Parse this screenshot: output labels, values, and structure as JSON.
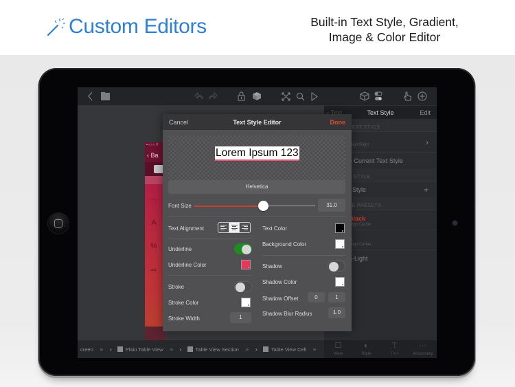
{
  "banner": {
    "title": "Custom Editors",
    "title_icon": "magic-wand-icon",
    "subtitle_line1": "Built-in Text Style, Gradient,",
    "subtitle_line2": "Image & Color Editor",
    "accent": "#2e7fd6"
  },
  "toolbar": {
    "icons": [
      "back-chevron-icon",
      "folder-icon",
      "undo-icon",
      "redo-icon",
      "lock-icon",
      "layers-icon",
      "fullscreen-icon",
      "search-icon",
      "play-icon",
      "cube-icon",
      "toggles-icon",
      "hand-icon",
      "add-circle-icon"
    ]
  },
  "phone_preview": {
    "status": "••○○○ V",
    "nav_back": "‹ Ba"
  },
  "panel": {
    "back_label": "‹ Text",
    "title": "Text Style",
    "edit_label": "Edit",
    "section_current": "TEXT STYLE",
    "current_sub": "Align Right",
    "current_action": "e Current Text Style",
    "section_new": "T STYLE",
    "new_label": "t Style",
    "section_presets": "LE PRESETS",
    "presets": [
      {
        "name": "Black",
        "sub": "Align Center",
        "color": "#c0392b"
      },
      {
        "name": "a",
        "sub": "Align Center",
        "color": "#8a8b90"
      },
      {
        "name": "a-Light",
        "sub": "",
        "color": "#8a8b90"
      }
    ]
  },
  "breadcrumb": {
    "items": [
      "creen",
      "Plain Table View",
      "Table View Section",
      "Table View Cell"
    ]
  },
  "inspector_tabs": [
    {
      "label": "View",
      "icon": "view-square-icon"
    },
    {
      "label": "Style",
      "icon": "style-toggle-icon"
    },
    {
      "label": "Text",
      "icon": "text-t-icon"
    },
    {
      "label": "Accessory",
      "icon": "ellipsis-icon"
    }
  ],
  "editor": {
    "cancel_label": "Cancel",
    "title": "Text Style Editor",
    "done_label": "Done",
    "done_color": "#e0502c",
    "preview_text": "Lorem Ipsum 123",
    "font_name": "Helvetica",
    "font_size_label": "Font Size",
    "font_size_value": "31.0",
    "font_size_fraction": 0.57,
    "text_alignment_label": "Text Alignment",
    "text_alignment_options": [
      "left",
      "center",
      "right"
    ],
    "text_alignment_selected": "center",
    "text_color_label": "Text Color",
    "text_color": "#000000",
    "background_color_label": "Background Color",
    "background_color": "#ffffff",
    "underline_label": "Underline",
    "underline_on": true,
    "underline_color_label": "Underline Color",
    "underline_color": "#e8365a",
    "shadow_label": "Shadow",
    "shadow_on": false,
    "shadow_color_label": "Shadow Color",
    "shadow_color": "#ffffff",
    "shadow_offset_label": "Shadow Offset",
    "shadow_offset_x": "0",
    "shadow_offset_y": "1",
    "shadow_blur_label": "Shadow Blur Radius",
    "shadow_blur_value": "1.0",
    "stroke_label": "Stroke",
    "stroke_on": false,
    "stroke_color_label": "Stroke Color",
    "stroke_color": "#ffffff",
    "stroke_width_label": "Stroke Width",
    "stroke_width_value": "1"
  }
}
